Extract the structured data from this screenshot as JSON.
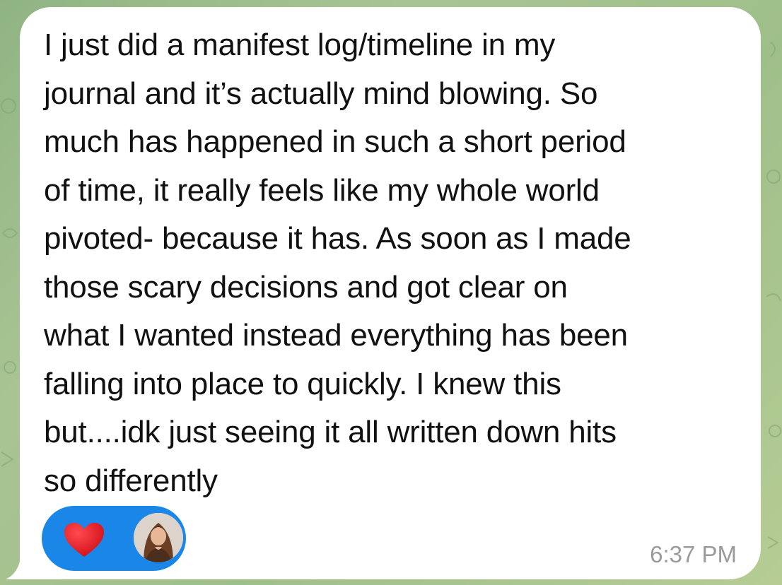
{
  "message": {
    "text": "I just did a manifest log/timeline in my\njournal and it’s actually mind blowing. So\nmuch has happened in such a short period\nof time, it really feels like my whole world\npivoted- because it has. As soon as I made\nthose scary decisions and got clear on\nwhat I wanted instead everything has been\nfalling into place to quickly. I knew this\nbut....idk just seeing it all written down hits\nso differently",
    "timestamp": "6:37 PM"
  },
  "reaction": {
    "emoji_icon": "heart-icon",
    "reactor_icon": "avatar"
  },
  "colors": {
    "bubble": "#ffffff",
    "reaction_pill": "#1a86e8",
    "heart": "#e8141c",
    "timestamp": "#9a9a9a",
    "wallpaper": "#a3c28e"
  }
}
